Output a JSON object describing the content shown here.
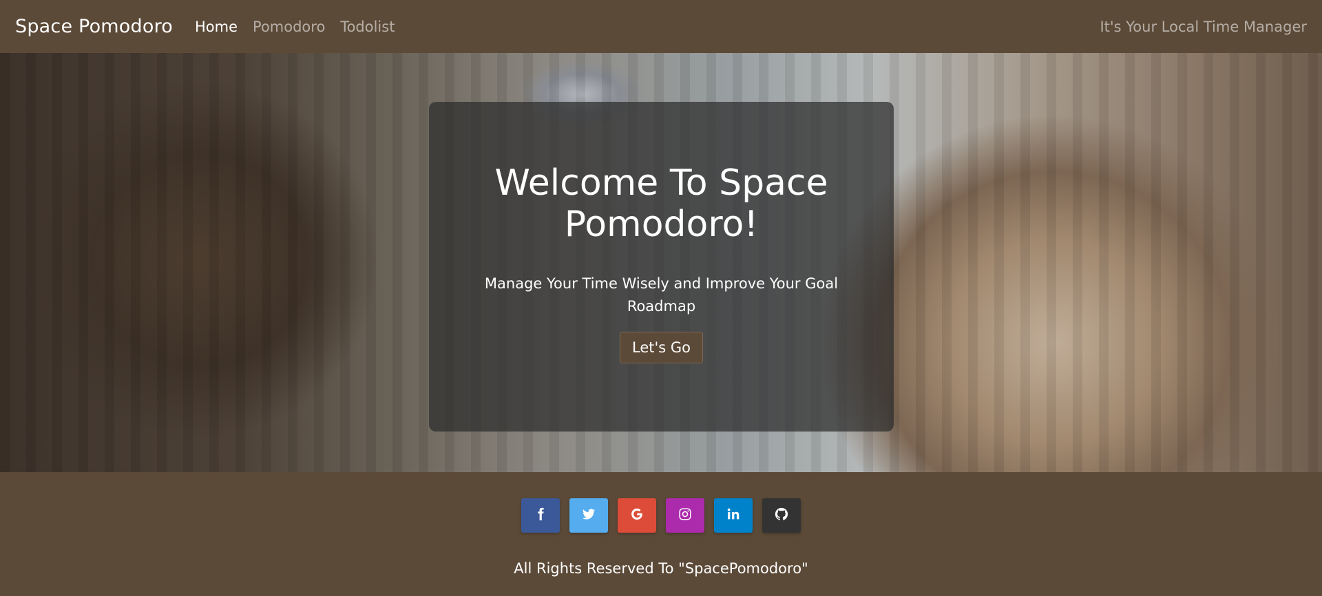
{
  "nav": {
    "brand": "Space Pomodoro",
    "links": [
      {
        "label": "Home",
        "active": true
      },
      {
        "label": "Pomodoro",
        "active": false
      },
      {
        "label": "Todolist",
        "active": false
      }
    ],
    "tagline": "It's Your Local Time Manager"
  },
  "hero": {
    "title": "Welcome To Space Pomodoro!",
    "subtitle": "Manage Your Time Wisely and Improve Your Goal Roadmap",
    "button_label": "Let's Go"
  },
  "footer": {
    "social": [
      {
        "icon": "facebook-icon",
        "color": "#3b5998"
      },
      {
        "icon": "twitter-icon",
        "color": "#55acee"
      },
      {
        "icon": "google-icon",
        "color": "#dd4b39"
      },
      {
        "icon": "instagram-icon",
        "color": "#ac2bac"
      },
      {
        "icon": "linkedin-icon",
        "color": "#0082ca"
      },
      {
        "icon": "github-icon",
        "color": "#333333"
      }
    ],
    "copyright": "All Rights Reserved To \"SpacePomodoro\""
  },
  "colors": {
    "brand_brown": "#5c4a38",
    "card_overlay": "#2d2d2d"
  }
}
